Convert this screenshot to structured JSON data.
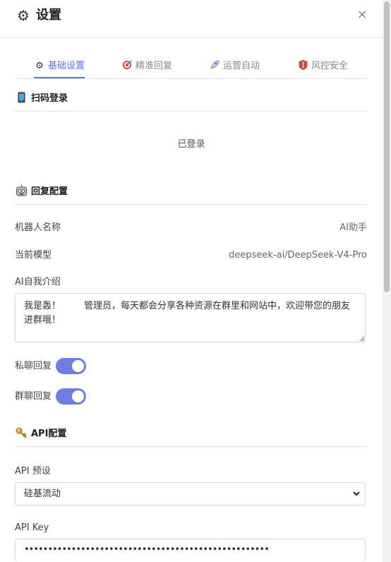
{
  "header": {
    "title": "设置",
    "close_label": "×"
  },
  "tabs": [
    {
      "label": "基础设置",
      "icon": "gear-icon"
    },
    {
      "label": "精准回复",
      "icon": "target-icon"
    },
    {
      "label": "运营自动",
      "icon": "rocket-icon"
    },
    {
      "label": "风控安全",
      "icon": "shield-icon"
    }
  ],
  "scan_login": {
    "title": "扫码登录",
    "status": "已登录"
  },
  "reply_config": {
    "title": "回复配置",
    "bot_name_label": "机器人名称",
    "bot_name_value": "AI助手",
    "model_label": "当前模型",
    "model_value": "deepseek-ai/DeepSeek-V4-Pro",
    "intro_label": "AI自我介绍",
    "intro_value": "我是轰！        管理员，每天都会分享各种资源在群里和网站中，欢迎带您的朋友进群哦！",
    "private_reply_label": "私聊回复",
    "private_reply_on": true,
    "group_reply_label": "群聊回复",
    "group_reply_on": true
  },
  "api_config": {
    "title": "API配置",
    "preset_label": "API 预设",
    "preset_value": "硅基流动",
    "key_label": "API Key",
    "key_value": "••••••••••••••••••••••••••••••••••••••••••••••••••••"
  },
  "colors": {
    "accent": "#5b73e8",
    "toggle": "#6b7fe3"
  }
}
